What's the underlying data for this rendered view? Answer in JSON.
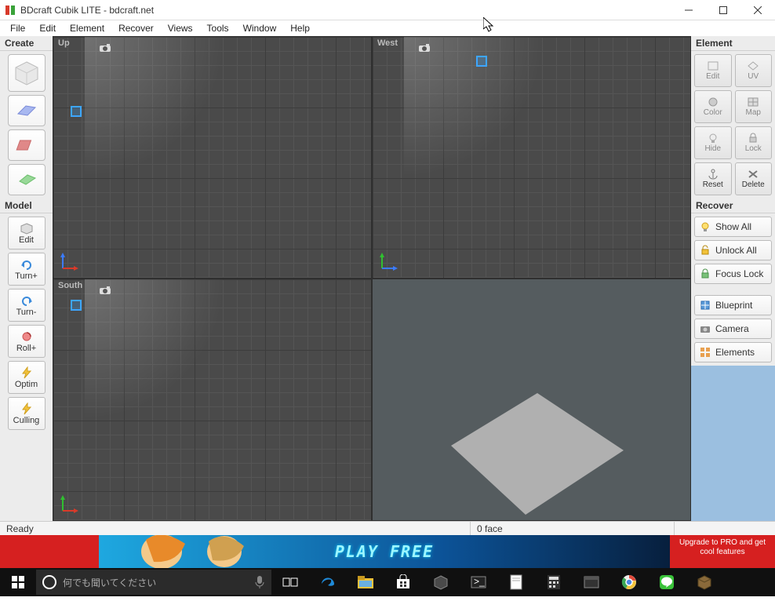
{
  "window": {
    "title": "BDcraft Cubik LITE - bdcraft.net"
  },
  "menubar": [
    "File",
    "Edit",
    "Element",
    "Recover",
    "Views",
    "Tools",
    "Window",
    "Help"
  ],
  "leftpanel": {
    "create_header": "Create",
    "model_header": "Model",
    "model_buttons": {
      "edit": "Edit",
      "turn_plus": "Turn+",
      "turn_minus": "Turn-",
      "roll_plus": "Roll+",
      "optim": "Optim",
      "culling": "Culling"
    }
  },
  "viewports": {
    "up": "Up",
    "west": "West",
    "south": "South"
  },
  "rightpanel": {
    "element_header": "Element",
    "element_buttons": {
      "edit": "Edit",
      "uv": "UV",
      "color": "Color",
      "map": "Map",
      "hide": "Hide",
      "lock": "Lock",
      "reset": "Reset",
      "delete": "Delete"
    },
    "recover_header": "Recover",
    "recover_buttons": {
      "show_all": "Show All",
      "unlock_all": "Unlock All",
      "focus_lock": "Focus Lock",
      "blueprint": "Blueprint",
      "camera": "Camera",
      "elements": "Elements"
    }
  },
  "statusbar": {
    "ready": "Ready",
    "faces": "0 face"
  },
  "ad": {
    "play": "PLAY FREE",
    "upgrade": "Upgrade to PRO and get cool features"
  },
  "taskbar": {
    "search_placeholder": "何でも聞いてください"
  }
}
